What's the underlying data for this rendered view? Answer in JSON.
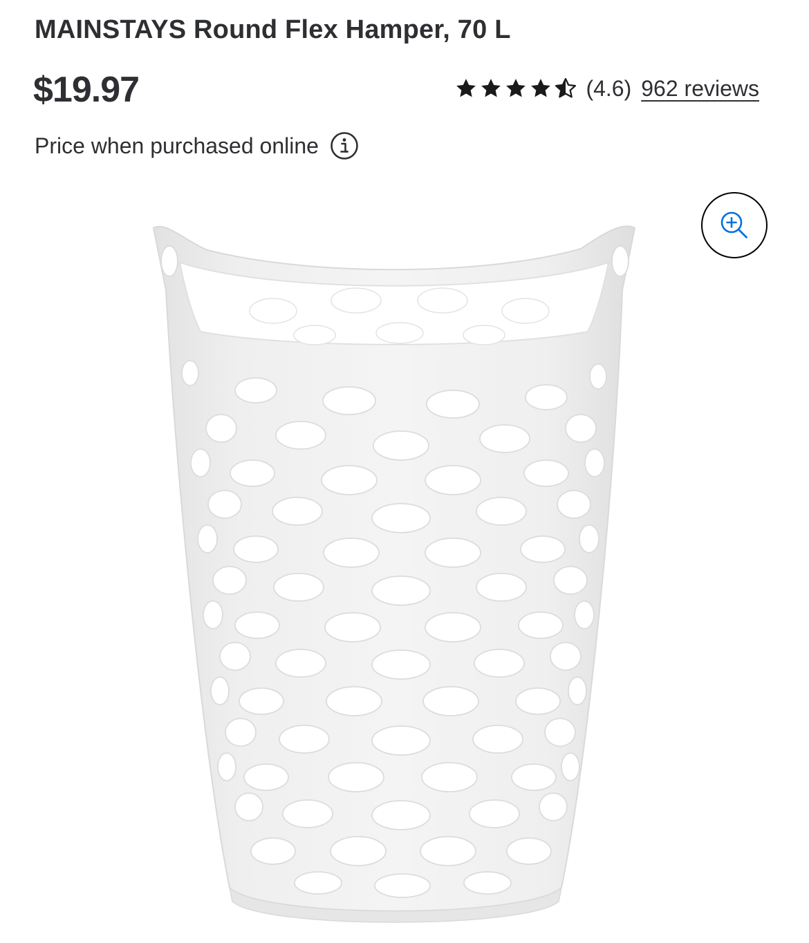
{
  "product": {
    "title": "MAINSTAYS Round Flex Hamper, 70 L",
    "price": "$19.97",
    "price_note": "Price when purchased online"
  },
  "rating": {
    "value": 4.6,
    "value_text": "(4.6)",
    "max": 5,
    "reviews_text": "962 reviews"
  },
  "icons": {
    "star": "star-icon",
    "info": "info-icon",
    "zoom": "zoom-in-icon"
  },
  "colors": {
    "text": "#2e2f32",
    "zoom_accent": "#0071dc",
    "product": "#ececec"
  }
}
